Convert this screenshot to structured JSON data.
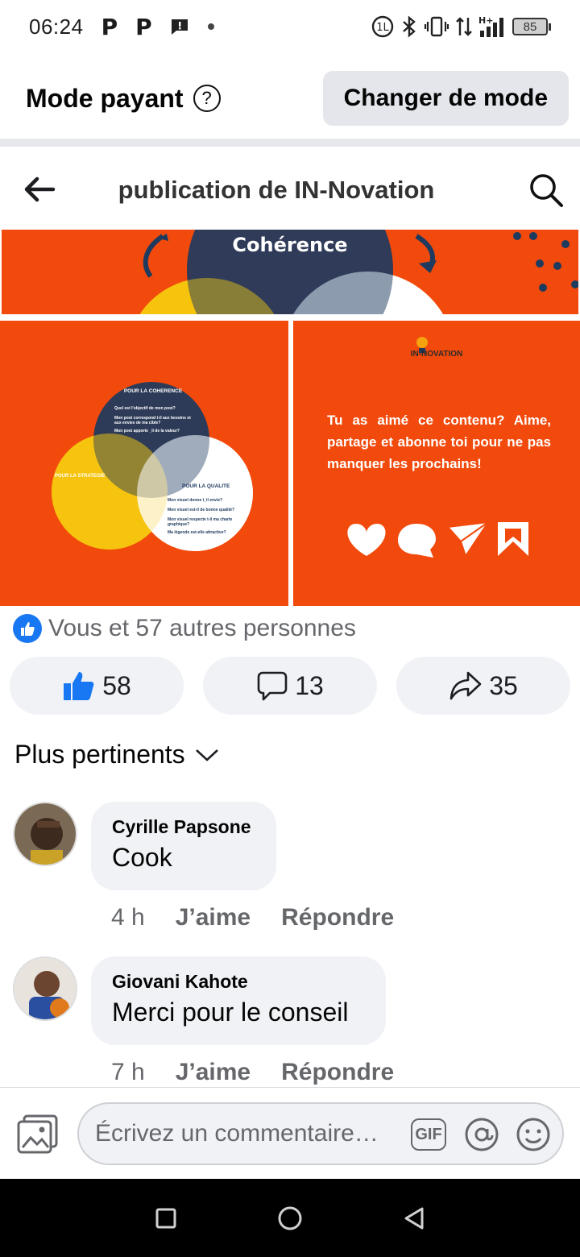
{
  "status_bar": {
    "time": "06:24",
    "notif_icons": [
      "P",
      "P"
    ],
    "battery": "85"
  },
  "mode_bar": {
    "title": "Mode payant",
    "button": "Changer de mode"
  },
  "header": {
    "title": "publication de IN-Novation"
  },
  "post_images": {
    "top_heading": "Cohérence",
    "left_circle_top_title": "POUR LA COHERENCE",
    "left_circle_top_lines": [
      "Quel est l'objectif de mon post?",
      "Mon post correspond t-il aux besoins et aux envies de ma cible?",
      "Mon post apporte _il de la valeur?"
    ],
    "left_circle_left_title": "POUR LA STRATEGIE",
    "left_circle_right_title": "POUR LA QUALITE",
    "left_circle_right_lines": [
      "Mon visuel donne t_il envie?",
      "Mon visuel est-il de bonne qualité?",
      "Mon visuel respecte t-il ma charte graphique?",
      "Ma légende est-elle attractive?"
    ],
    "brand": "IN-NOVATION",
    "cta_text": "Tu as aimé ce contenu? Aime, partage et abonne toi pour ne pas manquer les prochains!"
  },
  "reactions": {
    "summary": "Vous et 57 autres personnes"
  },
  "actions": {
    "like_count": "58",
    "comment_count": "13",
    "share_count": "35"
  },
  "sort": {
    "label": "Plus pertinents"
  },
  "comments": [
    {
      "name": "Cyrille Papsone",
      "text": "Cook",
      "time": "4 h",
      "like": "J’aime",
      "reply": "Répondre"
    },
    {
      "name": "Giovani Kahote",
      "text": "Merci pour le conseil",
      "time": "7 h",
      "like": "J’aime",
      "reply": "Répondre"
    }
  ],
  "composer": {
    "placeholder": "Écrivez un commentaire…",
    "gif": "GIF"
  },
  "colors": {
    "accent": "#1877f2",
    "post_orange": "#f24a0c",
    "navy": "#1e3a5f",
    "yellow": "#f6c40e"
  }
}
